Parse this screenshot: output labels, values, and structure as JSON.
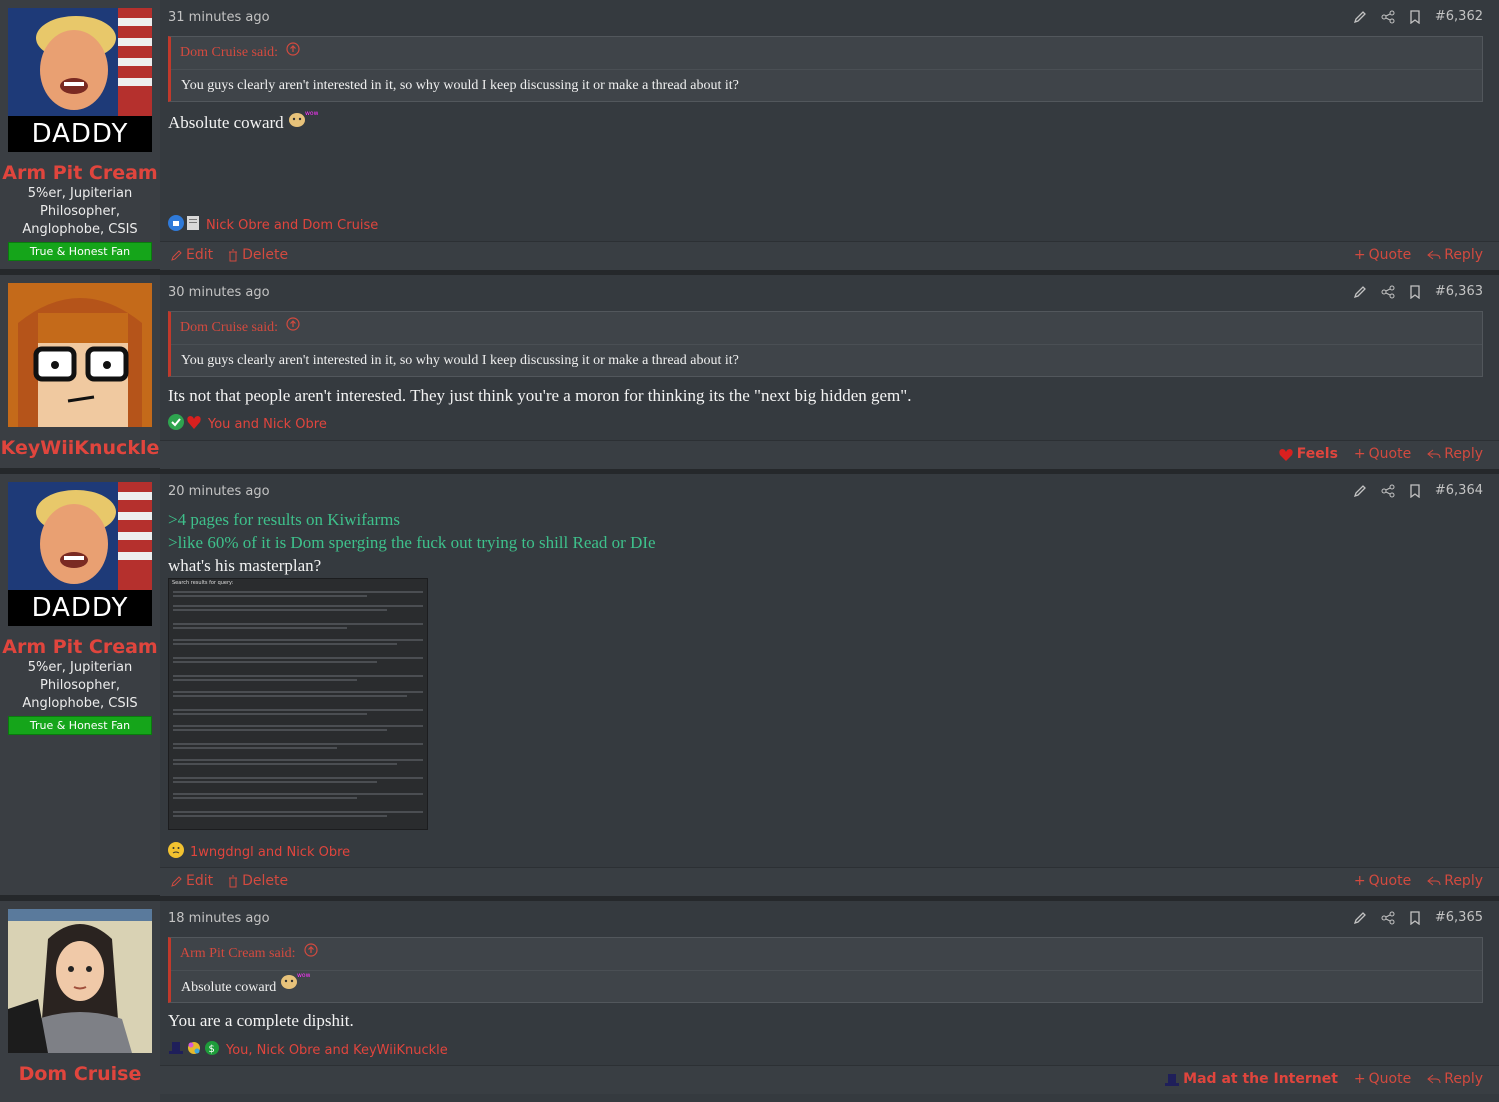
{
  "posts": [
    {
      "username": "Arm Pit Cream",
      "avatar_label": "DADDY",
      "user_title": [
        "5%er, Jupiterian",
        "Philosopher,",
        "Anglophobe, CSIS"
      ],
      "banner": "True & Honest Fan",
      "time": "31 minutes ago",
      "post_number": "#6,362",
      "quote_author": "Dom Cruise said:",
      "quote_text": "You guys clearly aren't interested in it, so why would I keep discussing it or make a thread about it?",
      "message": "Absolute coward",
      "reactions_names": "Nick Obre and Dom Cruise",
      "footer": {
        "edit": "Edit",
        "delete": "Delete",
        "quote": "Quote",
        "reply": "Reply"
      }
    },
    {
      "username": "KeyWiiKnuckle",
      "time": "30 minutes ago",
      "post_number": "#6,363",
      "quote_author": "Dom Cruise said:",
      "quote_text": "You guys clearly aren't interested in it, so why would I keep discussing it or make a thread about it?",
      "message": "Its not that people aren't interested. They just think you're a moron for thinking its the \"next big hidden gem\".",
      "reactions_names": "You and Nick Obre",
      "footer": {
        "react": "Feels",
        "quote": "Quote",
        "reply": "Reply"
      }
    },
    {
      "username": "Arm Pit Cream",
      "avatar_label": "DADDY",
      "user_title": [
        "5%er, Jupiterian",
        "Philosopher,",
        "Anglophobe, CSIS"
      ],
      "banner": "True & Honest Fan",
      "time": "20 minutes ago",
      "post_number": "#6,364",
      "green_lines": [
        ">4 pages for results on Kiwifarms",
        ">like 60% of it is Dom sperging the fuck out trying to shill Read or DIe"
      ],
      "message": "what's his masterplan?",
      "screenshot_caption": "Search results for query:",
      "reactions_names": "1wngdngl and Nick Obre",
      "footer": {
        "edit": "Edit",
        "delete": "Delete",
        "quote": "Quote",
        "reply": "Reply"
      }
    },
    {
      "username": "Dom Cruise",
      "time": "18 minutes ago",
      "post_number": "#6,365",
      "quote_author": "Arm Pit Cream said:",
      "quote_text": "Absolute coward",
      "message": "You are a complete dipshit.",
      "reactions_names": "You, Nick Obre and KeyWiiKnuckle",
      "footer": {
        "react": "Mad at the Internet",
        "quote": "Quote",
        "reply": "Reply"
      }
    }
  ],
  "colors": {
    "accent": "#e0453d",
    "green_text": "#3ec08b",
    "banner": "#15a51a"
  }
}
